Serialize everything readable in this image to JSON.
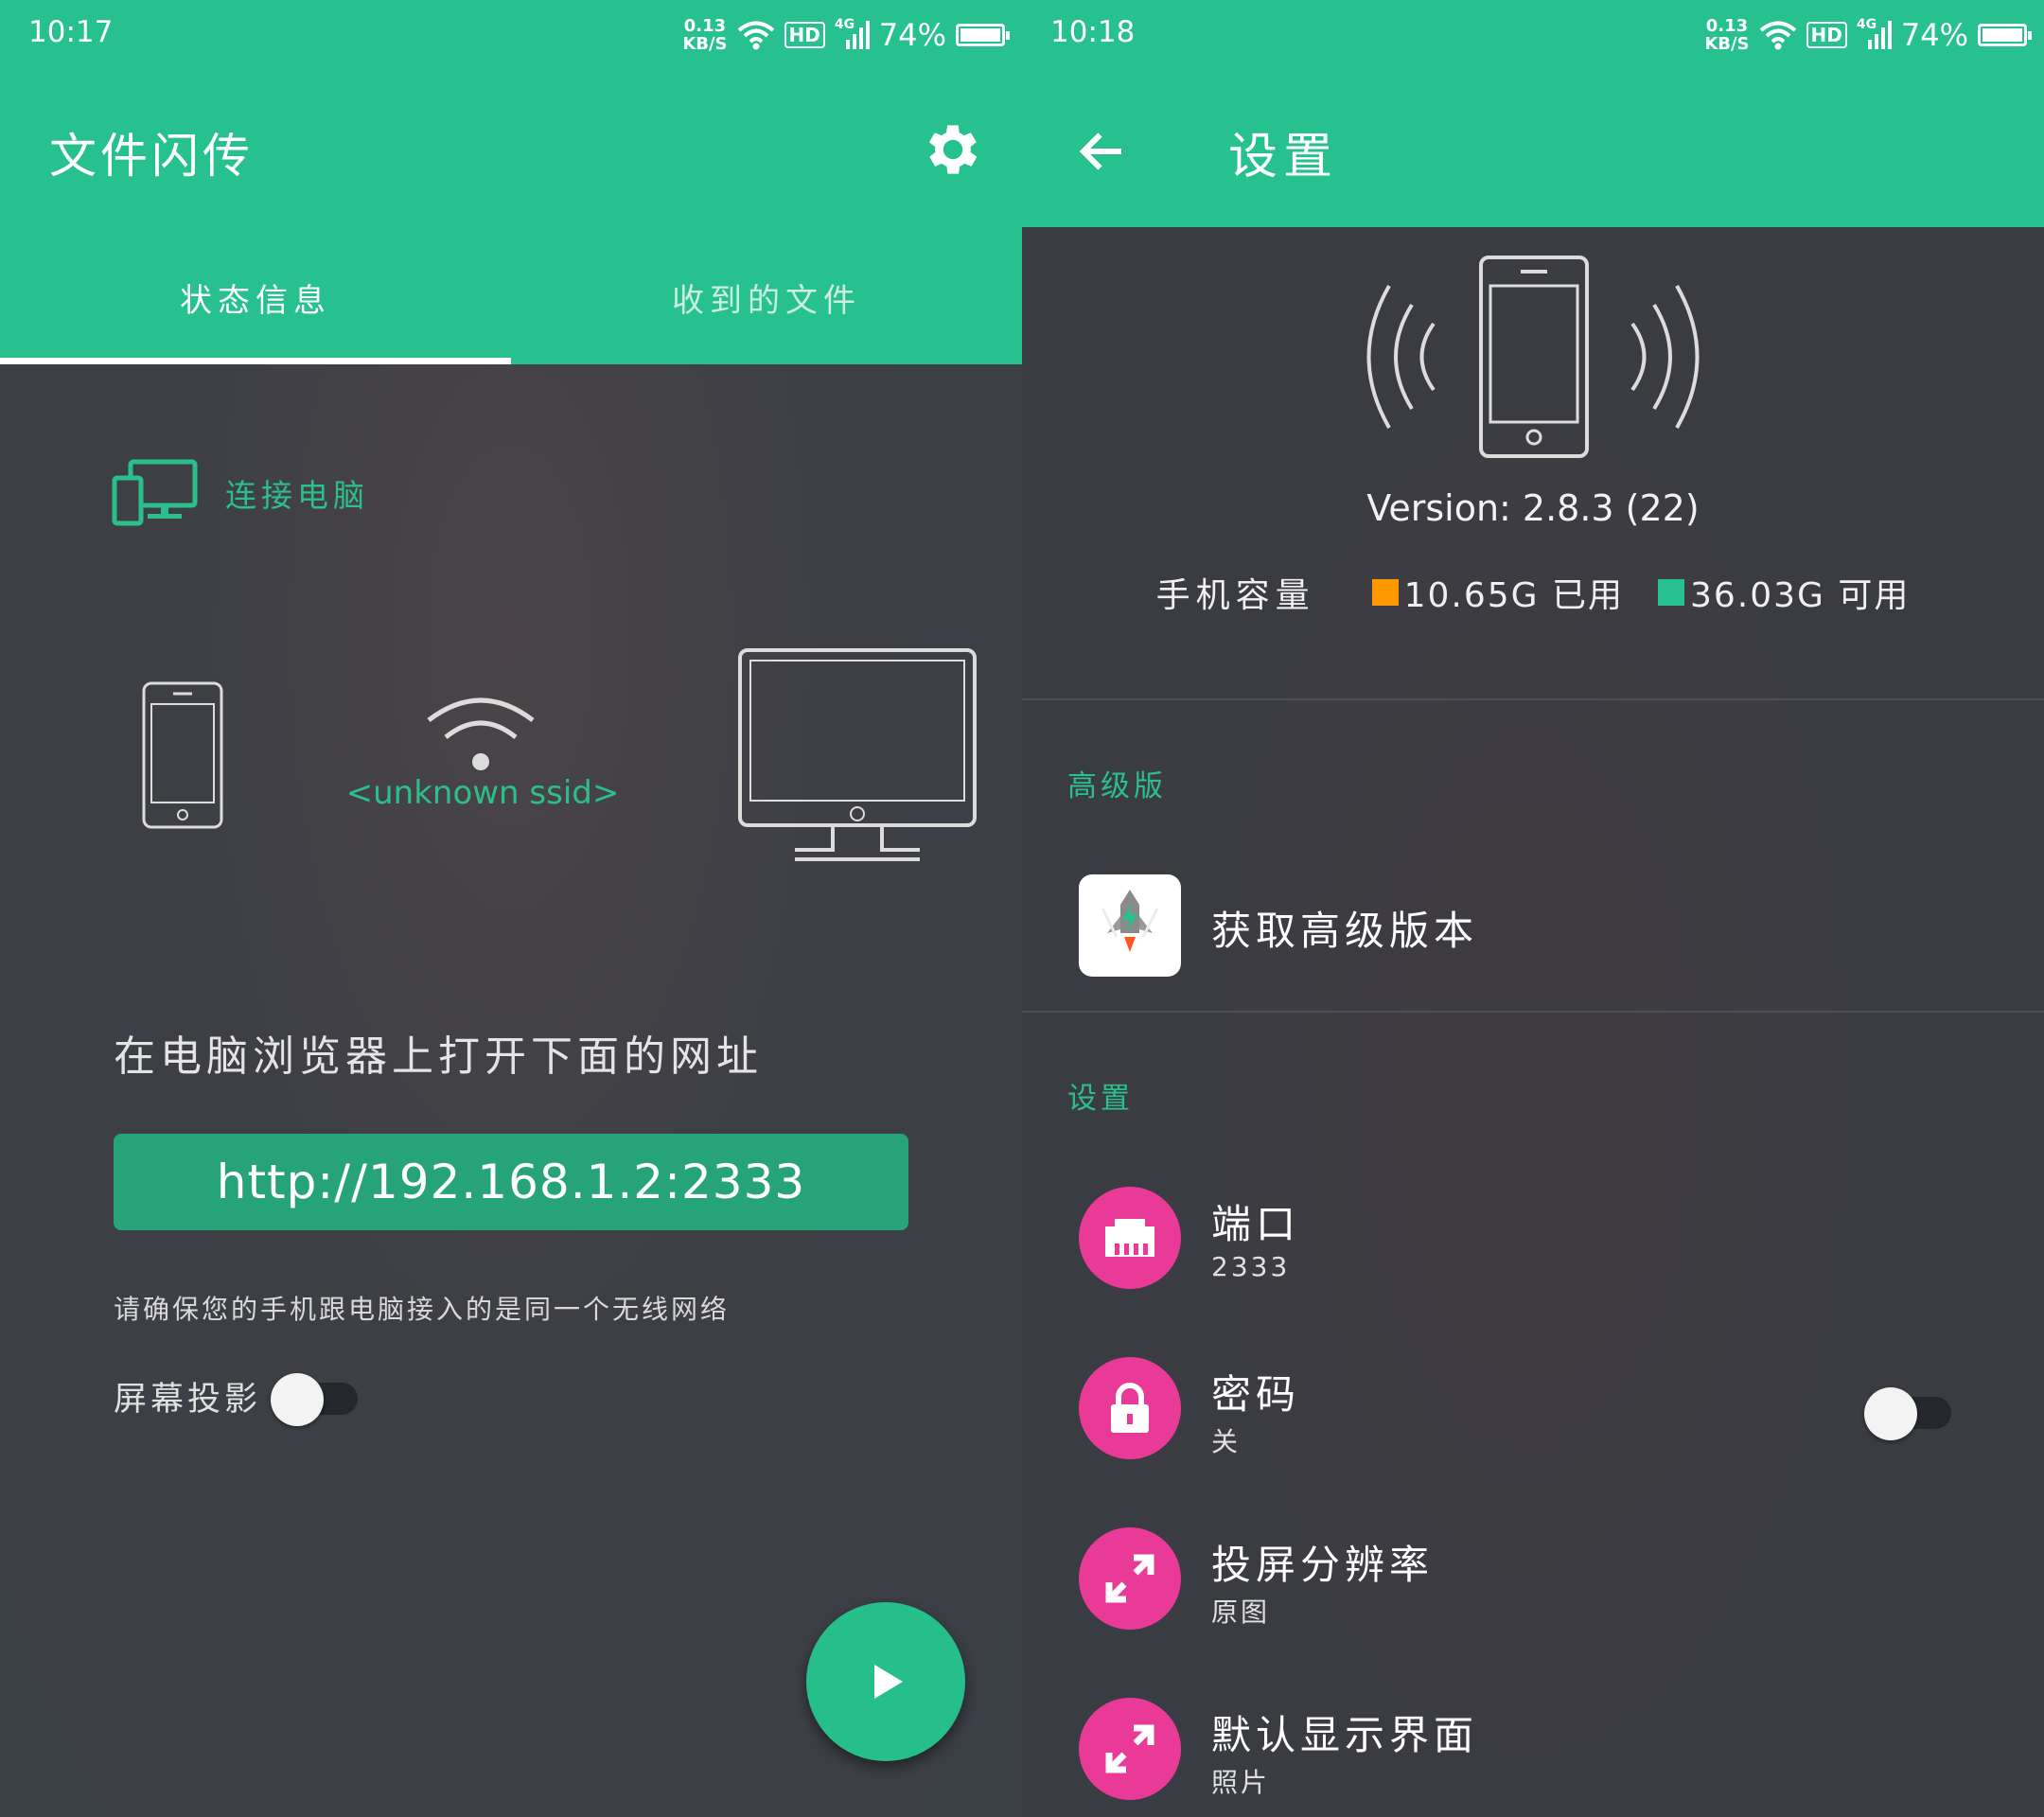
{
  "left": {
    "status": {
      "time": "10:17",
      "speed_value": "0.13",
      "speed_unit": "KB/S",
      "hd": "HD",
      "net": "4G",
      "battery": "74%"
    },
    "app_title": "文件闪传",
    "tabs": [
      {
        "label": "状态信息"
      },
      {
        "label": "收到的文件"
      }
    ],
    "connect_label": "连接电脑",
    "ssid": "<unknown ssid>",
    "instruction": "在电脑浏览器上打开下面的网址",
    "url": "http://192.168.1.2:2333",
    "note": "请确保您的手机跟电脑接入的是同一个无线网络",
    "screen_projection_label": "屏幕投影",
    "screen_projection_on": false
  },
  "right": {
    "status": {
      "time": "10:18",
      "speed_value": "0.13",
      "speed_unit": "KB/S",
      "hd": "HD",
      "net": "4G",
      "battery": "74%"
    },
    "title": "设置",
    "version": "Version: 2.8.3 (22)",
    "storage_label": "手机容量",
    "used": "10.65G 已用",
    "free": "36.03G 可用",
    "used_color": "#ff9800",
    "free_color": "#27c08f",
    "section_premium": "高级版",
    "premium_item": "获取高级版本",
    "section_settings": "设置",
    "items": [
      {
        "title": "端口",
        "subtitle": "2333",
        "icon": "ethernet-port-icon"
      },
      {
        "title": "密码",
        "subtitle": "关",
        "icon": "lock-icon",
        "toggle_on": false
      },
      {
        "title": "投屏分辨率",
        "subtitle": "原图",
        "icon": "expand-arrows-icon"
      },
      {
        "title": "默认显示界面",
        "subtitle": "照片",
        "icon": "expand-arrows-icon"
      }
    ]
  },
  "colors": {
    "accent": "#27c08f",
    "background": "#3a3e45",
    "setting_icon": "#ea3a98"
  }
}
